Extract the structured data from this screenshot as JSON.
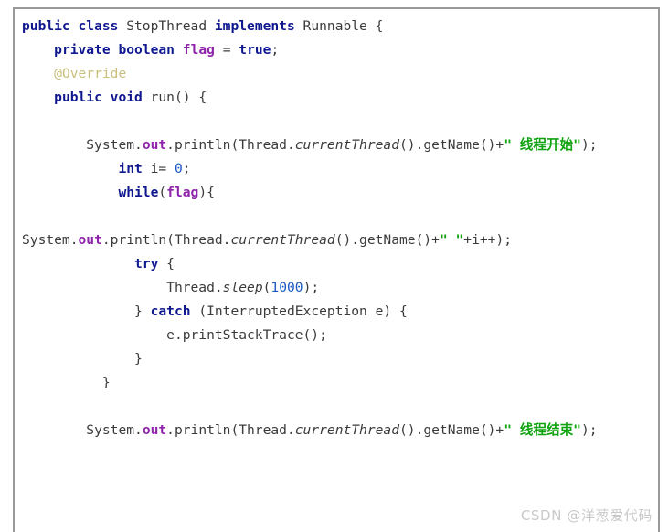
{
  "code_block": {
    "language": "java",
    "colors": {
      "keyword": "#10188f",
      "field": "#8e24aa",
      "string": "#10a310",
      "number": "#1a56c4",
      "annotation": "#c9bf7a",
      "plain": "#3b3b3b",
      "border": "#9a9a9a",
      "background": "#ffffff",
      "watermark": "#c9c9c9"
    },
    "lines": [
      {
        "id": "line-1",
        "indent": "",
        "tokens": [
          {
            "t": "public",
            "c": "kw"
          },
          {
            "t": " ",
            "c": "plain"
          },
          {
            "t": "class",
            "c": "kw"
          },
          {
            "t": " StopThread ",
            "c": "plain"
          },
          {
            "t": "implements",
            "c": "kw"
          },
          {
            "t": " Runnable {",
            "c": "plain"
          }
        ]
      },
      {
        "id": "line-2",
        "indent": "    ",
        "tokens": [
          {
            "t": "private",
            "c": "kw"
          },
          {
            "t": " ",
            "c": "plain"
          },
          {
            "t": "boolean",
            "c": "kw"
          },
          {
            "t": " ",
            "c": "plain"
          },
          {
            "t": "flag",
            "c": "field"
          },
          {
            "t": " = ",
            "c": "plain"
          },
          {
            "t": "true",
            "c": "kw"
          },
          {
            "t": ";",
            "c": "plain"
          }
        ]
      },
      {
        "id": "line-3",
        "indent": "    ",
        "tokens": [
          {
            "t": "@Override",
            "c": "anno"
          }
        ]
      },
      {
        "id": "line-4",
        "indent": "    ",
        "tokens": [
          {
            "t": "public",
            "c": "kw"
          },
          {
            "t": " ",
            "c": "plain"
          },
          {
            "t": "void",
            "c": "kw"
          },
          {
            "t": " run() {",
            "c": "plain"
          }
        ]
      },
      {
        "id": "line-5",
        "indent": "",
        "tokens": [
          {
            "t": "",
            "c": "plain"
          }
        ]
      },
      {
        "id": "line-6",
        "indent": "        ",
        "tokens": [
          {
            "t": "System.",
            "c": "plain"
          },
          {
            "t": "out",
            "c": "field"
          },
          {
            "t": ".println(Thread.",
            "c": "plain"
          },
          {
            "t": "currentThread",
            "c": "ital"
          },
          {
            "t": "().getName()+",
            "c": "plain"
          },
          {
            "t": "\" 线程开始\"",
            "c": "str"
          },
          {
            "t": ");",
            "c": "plain"
          }
        ]
      },
      {
        "id": "line-7",
        "indent": "            ",
        "tokens": [
          {
            "t": "int",
            "c": "kw"
          },
          {
            "t": " i= ",
            "c": "plain"
          },
          {
            "t": "0",
            "c": "num"
          },
          {
            "t": ";",
            "c": "plain"
          }
        ]
      },
      {
        "id": "line-8",
        "indent": "            ",
        "tokens": [
          {
            "t": "while",
            "c": "kw"
          },
          {
            "t": "(",
            "c": "plain"
          },
          {
            "t": "flag",
            "c": "field"
          },
          {
            "t": "){",
            "c": "plain"
          }
        ]
      },
      {
        "id": "line-9",
        "indent": "",
        "tokens": [
          {
            "t": "",
            "c": "plain"
          }
        ]
      },
      {
        "id": "line-10",
        "indent": "",
        "tokens": [
          {
            "t": "System.",
            "c": "plain"
          },
          {
            "t": "out",
            "c": "field"
          },
          {
            "t": ".println(Thread.",
            "c": "plain"
          },
          {
            "t": "currentThread",
            "c": "ital"
          },
          {
            "t": "().getName()+",
            "c": "plain"
          },
          {
            "t": "\" \"",
            "c": "str"
          },
          {
            "t": "+i++);",
            "c": "plain"
          }
        ]
      },
      {
        "id": "line-11",
        "indent": "              ",
        "tokens": [
          {
            "t": "try",
            "c": "kw"
          },
          {
            "t": " {",
            "c": "plain"
          }
        ]
      },
      {
        "id": "line-12",
        "indent": "                  ",
        "tokens": [
          {
            "t": "Thread.",
            "c": "plain"
          },
          {
            "t": "sleep",
            "c": "ital"
          },
          {
            "t": "(",
            "c": "plain"
          },
          {
            "t": "1000",
            "c": "num"
          },
          {
            "t": ");",
            "c": "plain"
          }
        ]
      },
      {
        "id": "line-13",
        "indent": "              ",
        "tokens": [
          {
            "t": "} ",
            "c": "plain"
          },
          {
            "t": "catch",
            "c": "kw"
          },
          {
            "t": " (InterruptedException e) {",
            "c": "plain"
          }
        ]
      },
      {
        "id": "line-14",
        "indent": "                  ",
        "tokens": [
          {
            "t": "e.printStackTrace();",
            "c": "plain"
          }
        ]
      },
      {
        "id": "line-15",
        "indent": "              ",
        "tokens": [
          {
            "t": "}",
            "c": "plain"
          }
        ]
      },
      {
        "id": "line-16",
        "indent": "          ",
        "tokens": [
          {
            "t": "}",
            "c": "plain"
          }
        ]
      },
      {
        "id": "line-17",
        "indent": "",
        "tokens": [
          {
            "t": "",
            "c": "plain"
          }
        ]
      },
      {
        "id": "line-18",
        "indent": "        ",
        "tokens": [
          {
            "t": "System.",
            "c": "plain"
          },
          {
            "t": "out",
            "c": "field"
          },
          {
            "t": ".println(Thread.",
            "c": "plain"
          },
          {
            "t": "currentThread",
            "c": "ital"
          },
          {
            "t": "().getName()+",
            "c": "plain"
          },
          {
            "t": "\" 线程结束\"",
            "c": "str"
          },
          {
            "t": ");",
            "c": "plain"
          }
        ]
      }
    ]
  },
  "watermark": {
    "text": "CSDN @洋葱爱代码"
  }
}
